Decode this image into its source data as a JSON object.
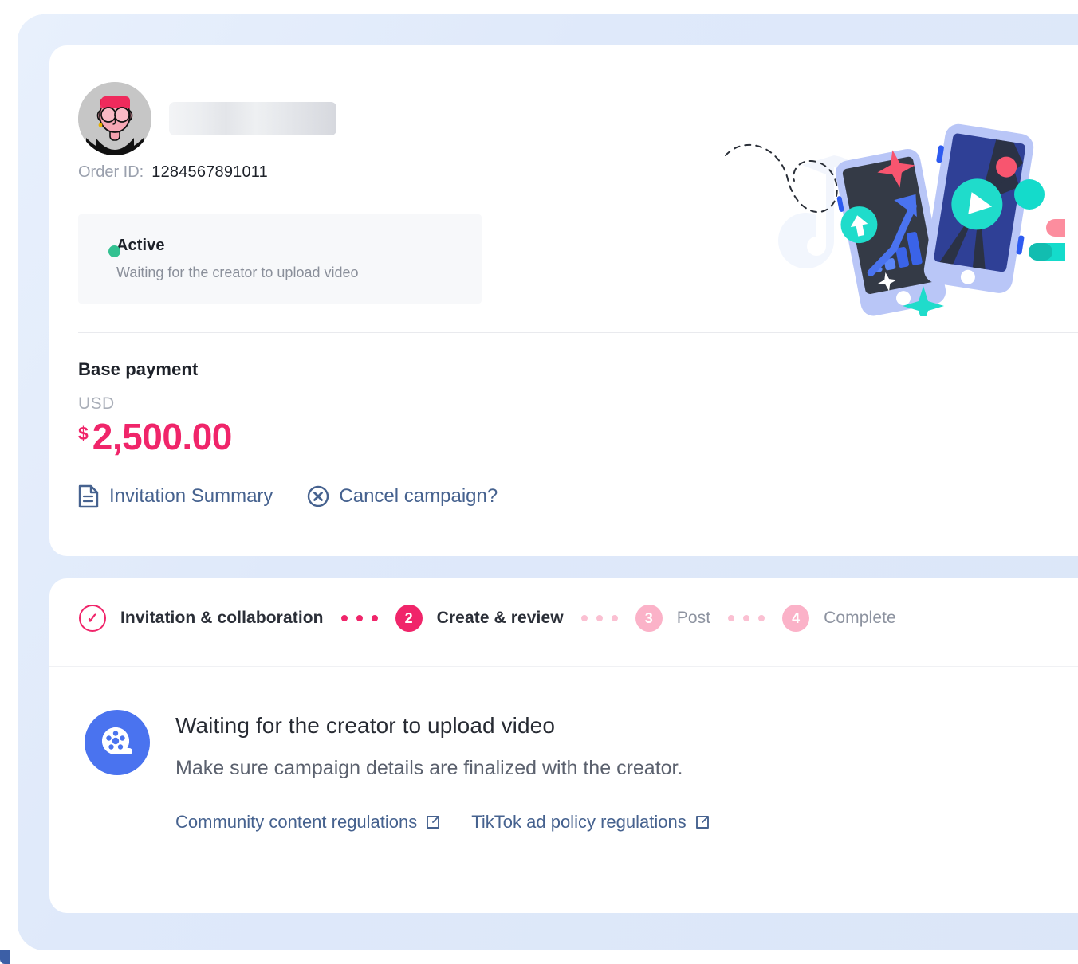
{
  "order": {
    "id_label": "Order ID:",
    "id_value": "1284567891011",
    "avatar_alt": "creator-avatar",
    "name_hidden": ""
  },
  "status": {
    "title": "Active",
    "subtitle": "Waiting for the creator to upload video",
    "dot_color": "#33c191"
  },
  "payment": {
    "title": "Base payment",
    "currency": "USD",
    "sign": "$",
    "amount": "2,500.00",
    "amount_color": "#f0256a"
  },
  "actions": [
    {
      "label": "Invitation Summary",
      "icon": "document-icon"
    },
    {
      "label": "Cancel campaign?",
      "icon": "circle-x-icon"
    }
  ],
  "stepper": {
    "steps": [
      {
        "badge": "✓",
        "label": "Invitation & collaboration",
        "state": "done"
      },
      {
        "badge": "2",
        "label": "Create & review",
        "state": "current"
      },
      {
        "badge": "3",
        "label": "Post",
        "state": "upcoming"
      },
      {
        "badge": "4",
        "label": "Complete",
        "state": "upcoming"
      }
    ]
  },
  "detail": {
    "icon": "film-reel-icon",
    "title": "Waiting for the creator to upload video",
    "subtitle": "Make sure campaign details are finalized with the creator.",
    "links": [
      {
        "label": "Community content regulations",
        "icon": "external-link-icon"
      },
      {
        "label": "TikTok ad policy regulations",
        "icon": "external-link-icon"
      }
    ]
  },
  "theme": {
    "accent_pink": "#f0256a",
    "link_blue": "#46628f",
    "badge_blue": "#4a73ef",
    "page_blue": "#dfe9fa",
    "teal": "#1fdccb"
  }
}
